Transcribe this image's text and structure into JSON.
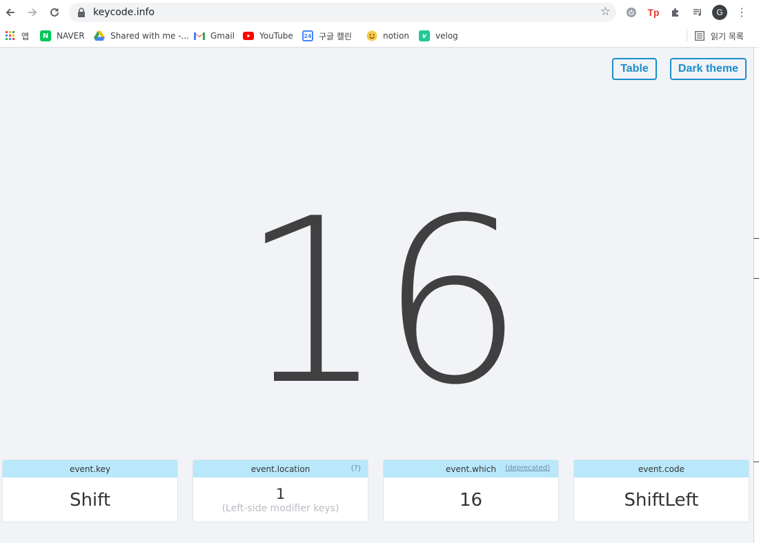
{
  "browser": {
    "url": "keycode.info",
    "bookmarks": [
      {
        "label": "앱",
        "icon": "apps-grid-icon"
      },
      {
        "label": "NAVER",
        "icon": "naver-icon"
      },
      {
        "label": "Shared with me -...",
        "icon": "google-drive-icon"
      },
      {
        "label": "Gmail",
        "icon": "gmail-icon"
      },
      {
        "label": "YouTube",
        "icon": "youtube-icon"
      },
      {
        "label": "구글 캘린",
        "icon": "google-calendar-icon"
      },
      {
        "label": "notion",
        "icon": "smiley-icon"
      },
      {
        "label": "velog",
        "icon": "velog-icon"
      }
    ],
    "reading_list": "읽기 목록",
    "profile_initial": "G",
    "calendar_day": "24",
    "naver_letter": "N",
    "velog_letter": "v",
    "ext_tp": "Tp"
  },
  "page": {
    "table_button": "Table",
    "theme_button": "Dark theme",
    "keycode": "16",
    "cards": {
      "key": {
        "title": "event.key",
        "value": "Shift"
      },
      "location": {
        "title": "event.location",
        "aside": "(?)",
        "value": "1",
        "sub": "(Left-side modifier keys)"
      },
      "which": {
        "title": "event.which",
        "aside": "(deprecated)",
        "value": "16"
      },
      "code": {
        "title": "event.code",
        "value": "ShiftLeft"
      }
    }
  },
  "colors": {
    "accent": "#1a8ec8",
    "card_header": "#b9e8fb",
    "background": "#f2f3f7"
  }
}
